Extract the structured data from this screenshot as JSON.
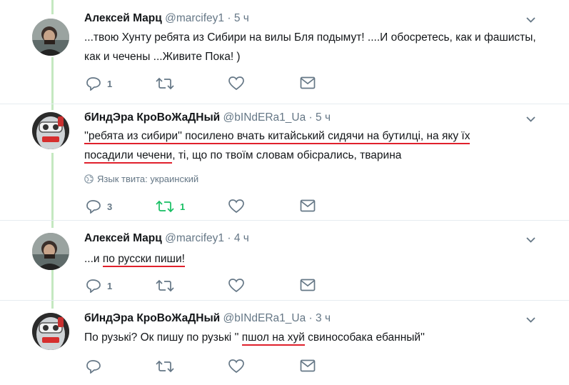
{
  "tweets": [
    {
      "author": "Алексей Марц",
      "handle": "@marcifey1",
      "dot": "·",
      "time": "5 ч",
      "text": "...твою Хунту ребята из Сибири на вилы Бля подымут! ....И обосретесь, как и фашисты, как и чечены ...Живите Пока! )",
      "reply_count": "1",
      "retweet_count": "",
      "like_count": ""
    },
    {
      "author": "бИндЭра КроВоЖаДНый",
      "handle": "@bINdERa1_Ua",
      "dot": "·",
      "time": "5 ч",
      "text_part1": "''ребята из сибири'' посилено вчать китайський сидячи на бутилці, на яку їх",
      "text_part2": "посадили чечени",
      "text_part3": ", ті, що по твоїм словам обісрались, тварина",
      "language_note": "Язык твита: украинский",
      "reply_count": "3",
      "retweet_count": "1",
      "like_count": ""
    },
    {
      "author": "Алексей Марц",
      "handle": "@marcifey1",
      "dot": "·",
      "time": "4 ч",
      "text_part1": "...и ",
      "text_part2": "по русски пиши!",
      "reply_count": "1",
      "retweet_count": "",
      "like_count": ""
    },
    {
      "author": "бИндЭра КроВоЖаДНый",
      "handle": "@bINdERa1_Ua",
      "dot": "·",
      "time": "3 ч",
      "text_part1": "По рузькі? Ок пишу по рузькі '' ",
      "text_part2": "пшол на хуй",
      "text_part3": " свиноcобака ебанный''",
      "reply_count": "",
      "retweet_count": "",
      "like_count": ""
    }
  ],
  "colors": {
    "thread_line": "#c4e8c0",
    "underline": "#e0202c",
    "retweet_active": "#17bf63",
    "muted": "#657786"
  },
  "icons": [
    "reply-icon",
    "retweet-icon",
    "like-icon",
    "dm-icon",
    "chevron-down-icon",
    "globe-icon"
  ]
}
